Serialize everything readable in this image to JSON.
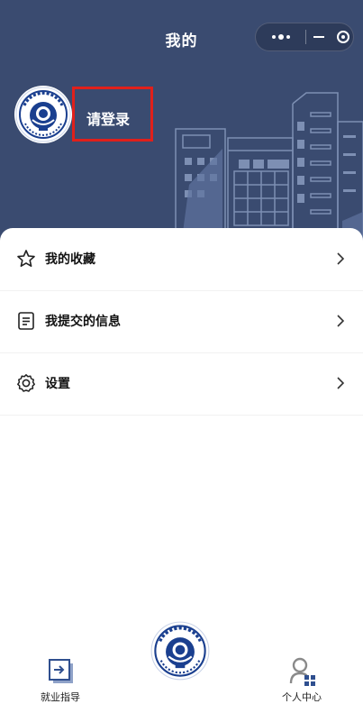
{
  "header": {
    "title": "我的",
    "login_prompt": "请登录",
    "avatar_logo_icon": "school-emblem-icon",
    "colors": {
      "background": "#3a4b70",
      "highlight_border": "#e0201b"
    }
  },
  "capsule": {
    "more_icon": "more-dots-icon",
    "minimize_icon": "minimize-icon",
    "close_icon": "target-close-icon"
  },
  "menu": {
    "items": [
      {
        "label": "我的收藏",
        "icon": "star-icon"
      },
      {
        "label": "我提交的信息",
        "icon": "document-list-icon"
      },
      {
        "label": "设置",
        "icon": "settings-gear-icon"
      }
    ]
  },
  "tabbar": {
    "items": [
      {
        "label": "就业指导",
        "icon": "employment-guide-icon"
      },
      {
        "label": "",
        "icon": "school-emblem-icon"
      },
      {
        "label": "个人中心",
        "icon": "personal-center-icon"
      }
    ]
  }
}
